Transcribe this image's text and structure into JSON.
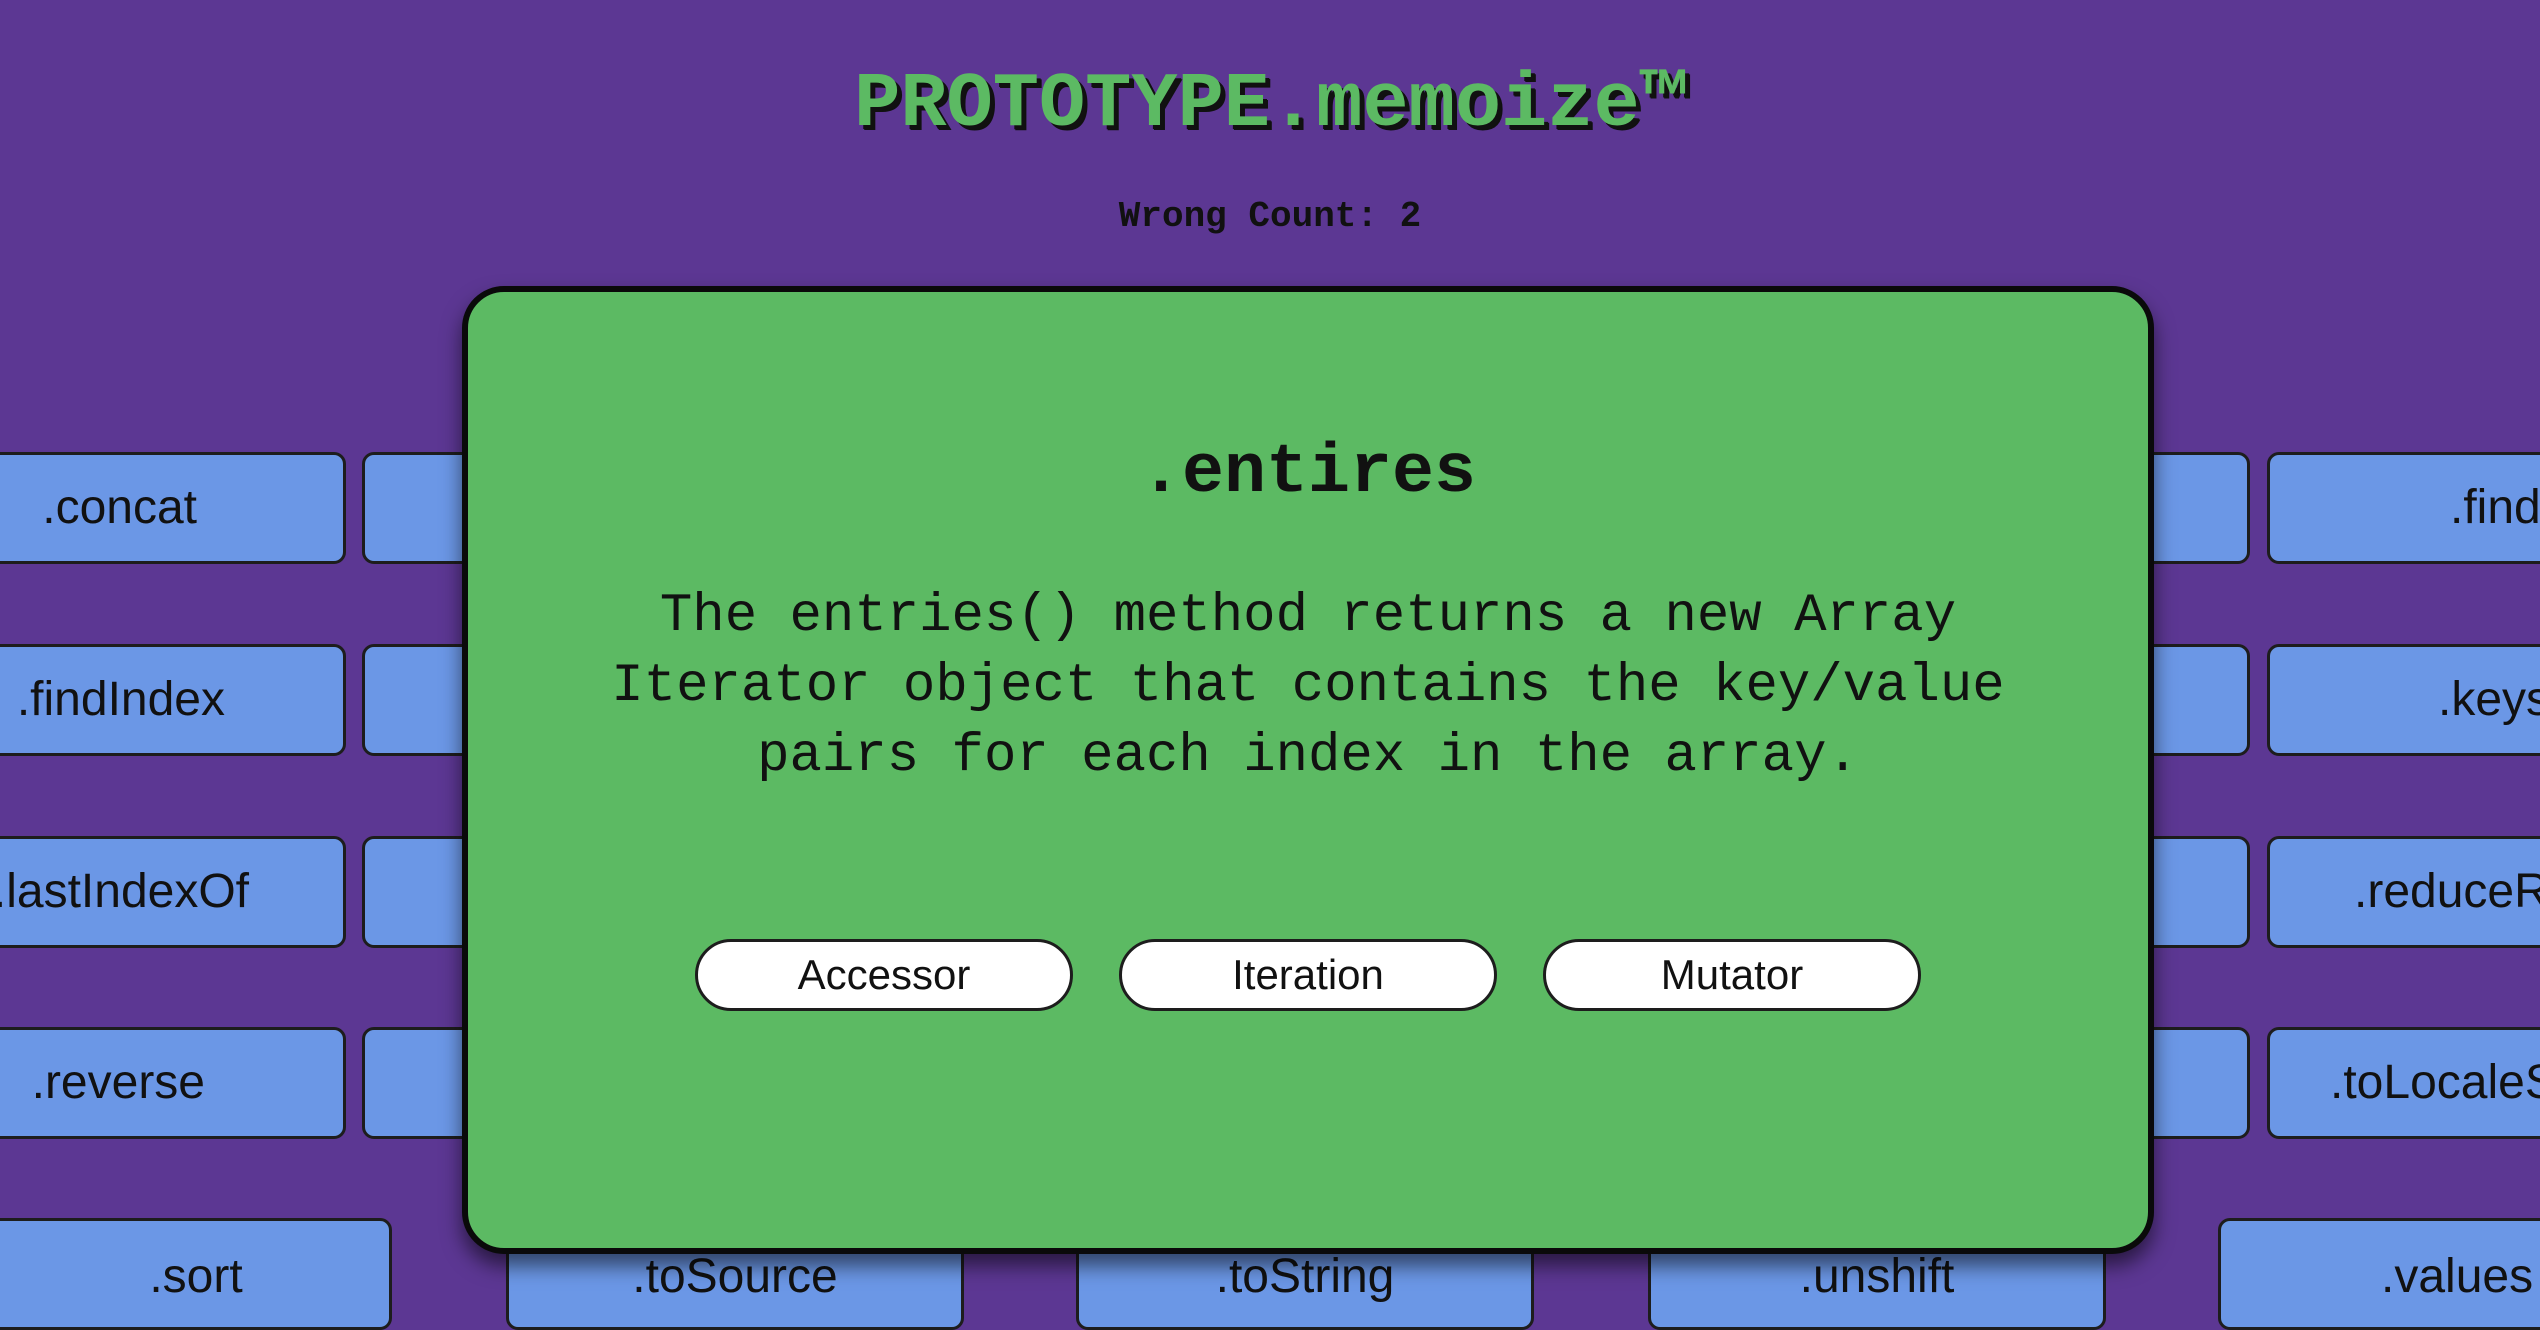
{
  "header": {
    "title": "PROTOTYPE.memoize™",
    "wrong_count": "Wrong Count: 2"
  },
  "background_cards": {
    "left_column": [
      ".concat",
      ".findIndex",
      ".lastIndexOf",
      ".reverse"
    ],
    "right_column": [
      ".find",
      ".keys",
      ".reduceR",
      ".toLocaleS"
    ],
    "bottom_row": [
      ".sort",
      ".toSource",
      ".toString",
      ".unshift",
      ".values"
    ]
  },
  "modal": {
    "method_name": ".entires",
    "description": "The entries() method returns a new Array Iterator object that contains the key/value pairs for each index in the array.",
    "choices": [
      "Accessor",
      "Iteration",
      "Mutator"
    ]
  },
  "colors": {
    "background": "#5c3793",
    "card": "#6b97e6",
    "modal": "#5cba63",
    "title": "#5cba63"
  }
}
